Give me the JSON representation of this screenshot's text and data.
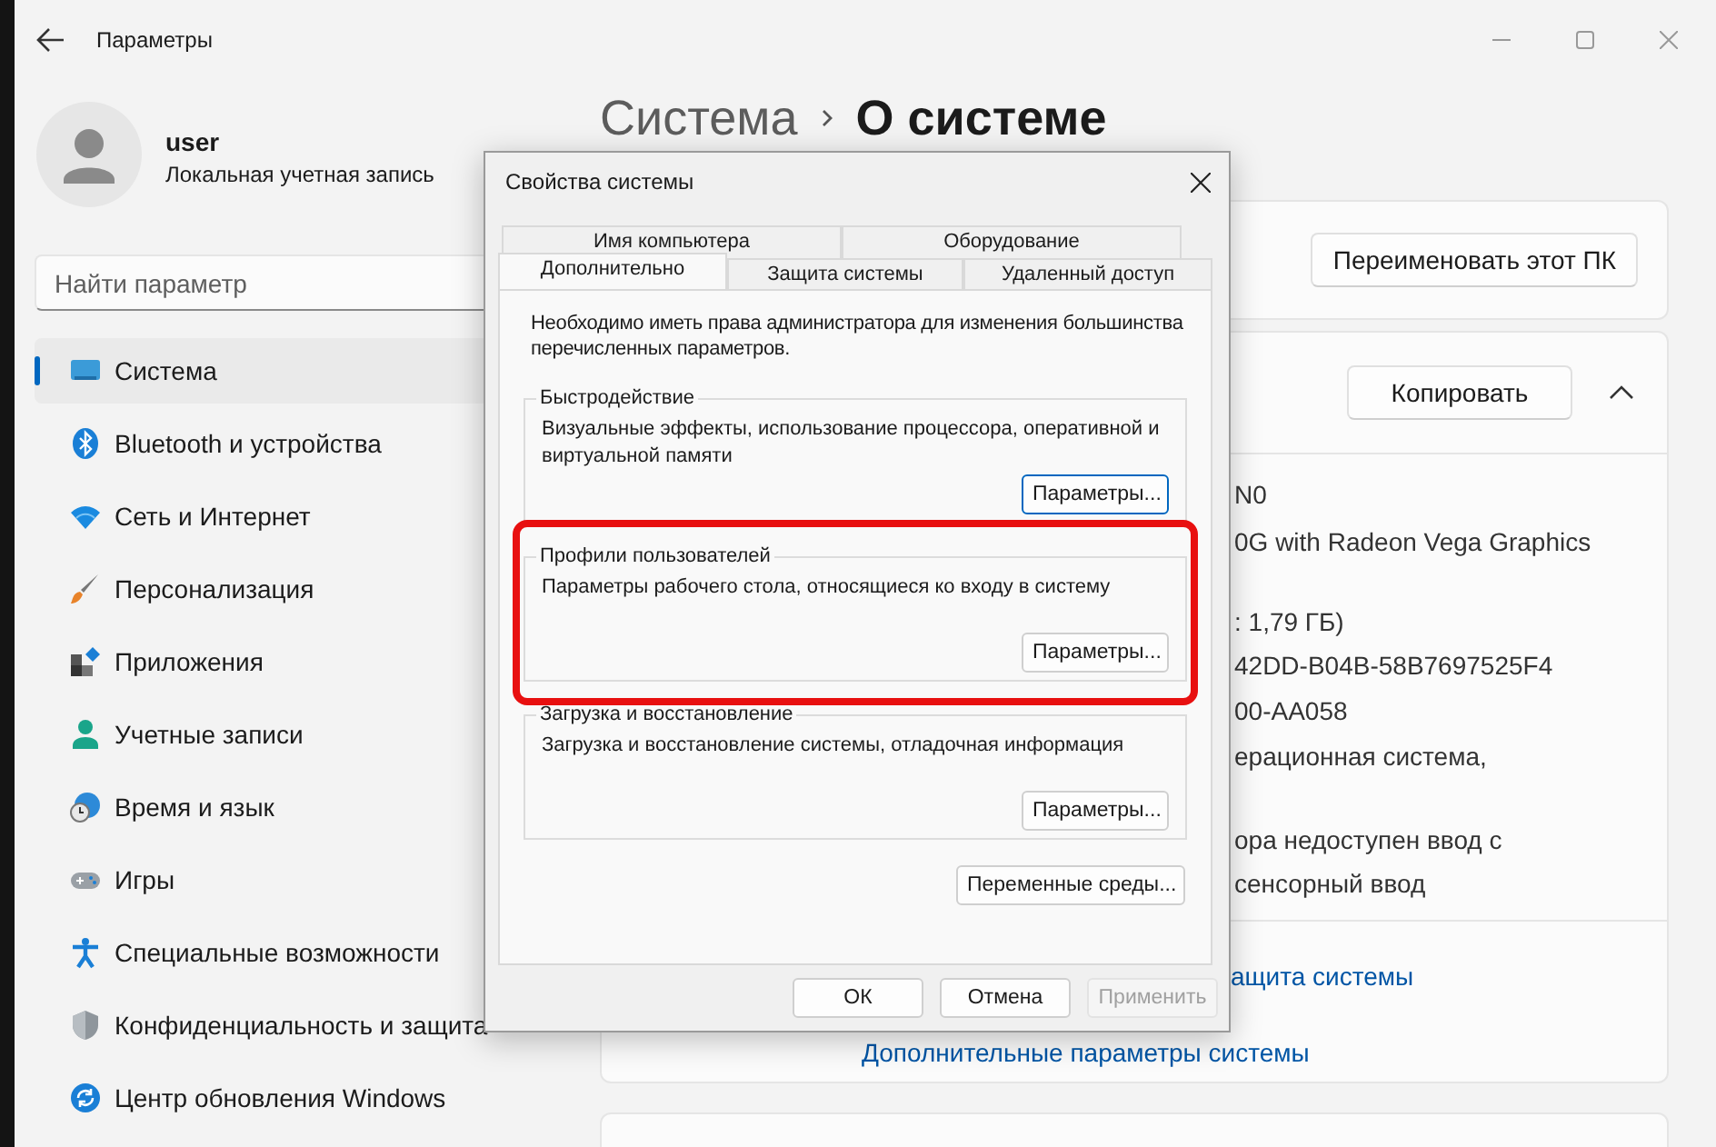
{
  "window": {
    "title": "Параметры"
  },
  "user": {
    "name": "user",
    "account_type": "Локальная учетная запись"
  },
  "search": {
    "placeholder": "Найти параметр"
  },
  "nav": [
    {
      "label": "Система",
      "selected": true
    },
    {
      "label": "Bluetooth и устройства",
      "selected": false
    },
    {
      "label": "Сеть и Интернет",
      "selected": false
    },
    {
      "label": "Персонализация",
      "selected": false
    },
    {
      "label": "Приложения",
      "selected": false
    },
    {
      "label": "Учетные записи",
      "selected": false
    },
    {
      "label": "Время и язык",
      "selected": false
    },
    {
      "label": "Игры",
      "selected": false
    },
    {
      "label": "Специальные возможности",
      "selected": false
    },
    {
      "label": "Конфиденциальность и защита",
      "selected": false
    },
    {
      "label": "Центр обновления Windows",
      "selected": false
    }
  ],
  "breadcrumb": {
    "parent": "Система",
    "current": "О системе"
  },
  "rename_button": "Переименовать этот ПК",
  "specs": {
    "copy_button": "Копировать",
    "expanded": true,
    "values": [
      [
        "N0"
      ],
      [
        "0G with Radeon Vega Graphics"
      ],
      [
        ": 1,79 ГБ)"
      ],
      [
        "42DD-B04B-58B7697525F4"
      ],
      [
        "00-AA058"
      ],
      [
        "ерационная система,"
      ],
      [
        "ора недоступен ввод с",
        "сенсорный ввод"
      ]
    ],
    "links": [
      "ащита системы",
      "Дополнительные параметры системы"
    ]
  },
  "dialog": {
    "title": "Свойства системы",
    "tab_rows": [
      [
        {
          "label": "Имя компьютера",
          "selected": false
        },
        {
          "label": "Оборудование",
          "selected": false
        }
      ],
      [
        {
          "label": "Дополнительно",
          "selected": true
        },
        {
          "label": "Защита системы",
          "selected": false
        },
        {
          "label": "Удаленный доступ",
          "selected": false
        }
      ]
    ],
    "note": "Необходимо иметь права администратора для изменения большинства перечисленных параметров.",
    "groups": [
      {
        "title": "Быстродействие",
        "description": "Визуальные эффекты, использование процессора, оперативной и виртуальной памяти",
        "button": "Параметры...",
        "focused": true,
        "highlighted": false
      },
      {
        "title": "Профили пользователей",
        "description": "Параметры рабочего стола, относящиеся ко входу в систему",
        "button": "Параметры...",
        "focused": false,
        "highlighted": true
      },
      {
        "title": "Загрузка и восстановление",
        "description": "Загрузка и восстановление системы, отладочная информация",
        "button": "Параметры...",
        "focused": false,
        "highlighted": false
      }
    ],
    "env_button": "Переменные среды...",
    "buttons": [
      {
        "label": "ОК",
        "disabled": false
      },
      {
        "label": "Отмена",
        "disabled": false
      },
      {
        "label": "Применить",
        "disabled": true
      }
    ]
  }
}
